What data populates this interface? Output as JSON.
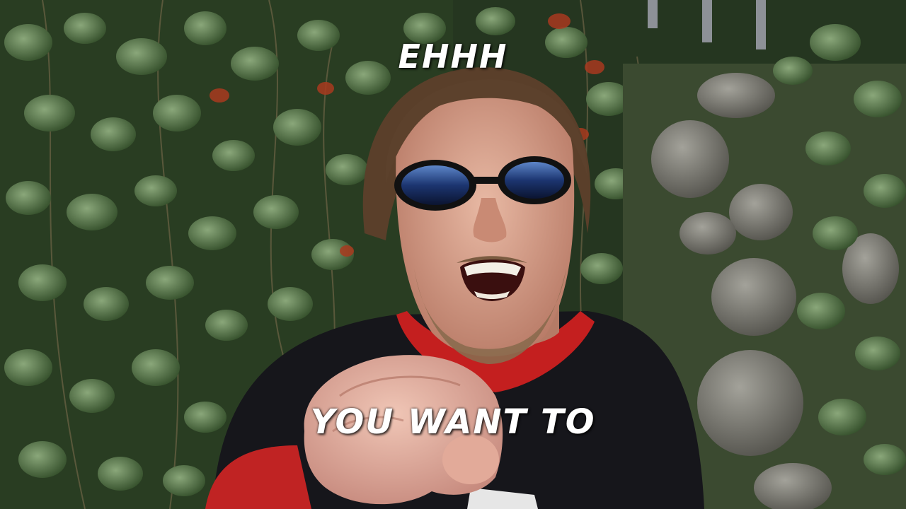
{
  "captions": {
    "top": "EHHH",
    "bottom": "YOU WANT TO"
  },
  "palette": {
    "caption_text": "#ffffff",
    "foliage_dark": "#22331c",
    "foliage_light": "#6f8a5c",
    "autumn_leaf": "#a03a24",
    "stone": "#7d7c73",
    "shirt": "#15151a",
    "undershirt": "#c41f1f",
    "skin": "#d9a08a",
    "hair": "#5a3f2a",
    "lenses": "#1f3e7a"
  }
}
